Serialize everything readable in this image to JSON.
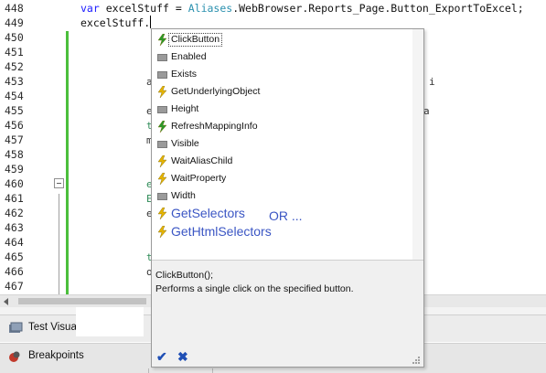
{
  "editor": {
    "line_numbers": [
      "448",
      "449",
      "450",
      "451",
      "452",
      "453",
      "454",
      "455",
      "456",
      "457",
      "458",
      "459",
      "460",
      "461",
      "462",
      "463",
      "464",
      "465",
      "466",
      "467"
    ],
    "code_line_448": {
      "keyword": "var",
      "rest": " excelStuff = ",
      "type_name": "Aliases",
      "tail": ".WebBrowser.Reports_Page.Button_ExportToExcel;"
    },
    "code_line_449": "excelStuff.",
    "behind_popup_fragments": {
      "f453": "a",
      "f455": "e",
      "f456": "t",
      "f457": "m",
      "f460": "e",
      "f461": "E",
      "f462": "e",
      "f465": "t",
      "f466": "o"
    },
    "right_fragments": {
      "r448": "Excel",
      "r453": "i",
      "r455": "a"
    }
  },
  "completion": {
    "items": [
      {
        "label": "ClickButton",
        "icon": "method-icon",
        "selected": true
      },
      {
        "label": "Enabled",
        "icon": "property-icon"
      },
      {
        "label": "Exists",
        "icon": "property-icon"
      },
      {
        "label": "GetUnderlyingObject",
        "icon": "method-icon"
      },
      {
        "label": "Height",
        "icon": "property-icon"
      },
      {
        "label": "RefreshMappingInfo",
        "icon": "method-icon"
      },
      {
        "label": "Visible",
        "icon": "property-icon"
      },
      {
        "label": "WaitAliasChild",
        "icon": "method-icon"
      },
      {
        "label": "WaitProperty",
        "icon": "method-icon"
      },
      {
        "label": "Width",
        "icon": "property-icon"
      },
      {
        "label": "GetSelectors",
        "icon": "method-icon",
        "big": true
      },
      {
        "label": "GetHtmlSelectors",
        "icon": "method-icon",
        "big": true
      }
    ],
    "or_note": "OR ...",
    "signature": "ClickButton();",
    "summary": "Performs a single click on the specified button.",
    "ok_glyph": "✔",
    "cancel_glyph": "✖"
  },
  "panels": {
    "visualizer_label": "Test Visua",
    "breakpoints_label": "Breakpoints"
  },
  "colors": {
    "method_icon": "#e6b400",
    "method_icon_green": "#2a9a2a",
    "accent_note": "#3b56c4",
    "change_bar": "#4bbf3c"
  }
}
